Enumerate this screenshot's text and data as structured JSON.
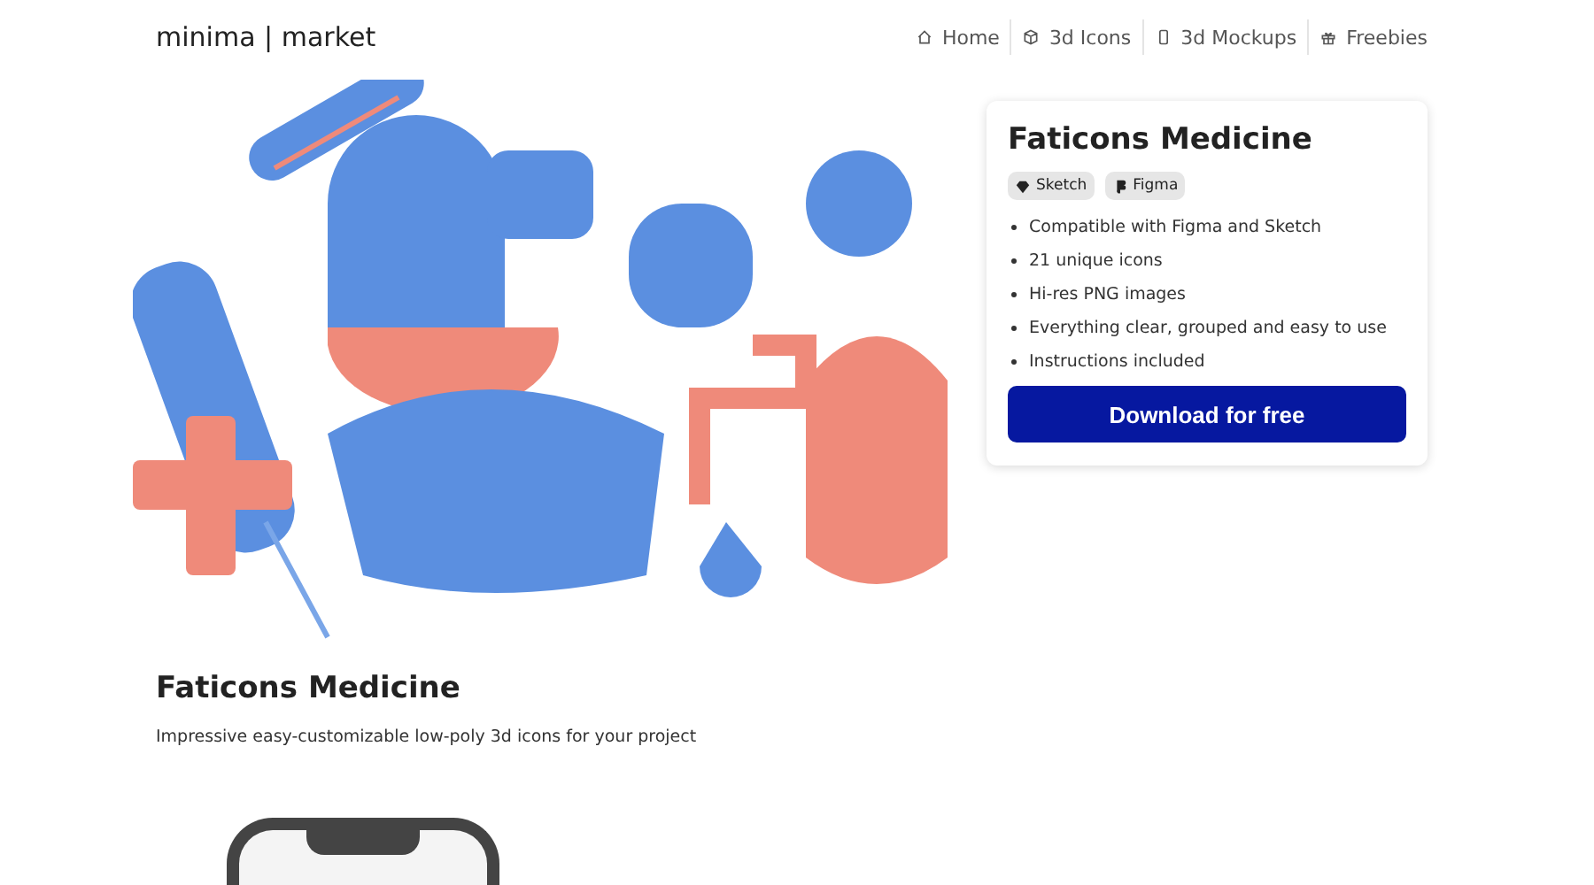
{
  "header": {
    "logo": "minima | market",
    "nav": [
      {
        "label": "Home"
      },
      {
        "label": "3d Icons"
      },
      {
        "label": "3d Mockups"
      },
      {
        "label": "Freebies"
      }
    ]
  },
  "card": {
    "title": "Faticons Medicine",
    "badges": [
      "Sketch",
      "Figma"
    ],
    "features": [
      "Compatible with Figma and Sketch",
      "21 unique icons",
      "Hi-res PNG images",
      "Everything clear, grouped and easy to use",
      "Instructions included"
    ],
    "button": "Download for free"
  },
  "product": {
    "title": "Faticons Medicine",
    "description": "Impressive easy-customizable low-poly 3d icons for your project"
  }
}
